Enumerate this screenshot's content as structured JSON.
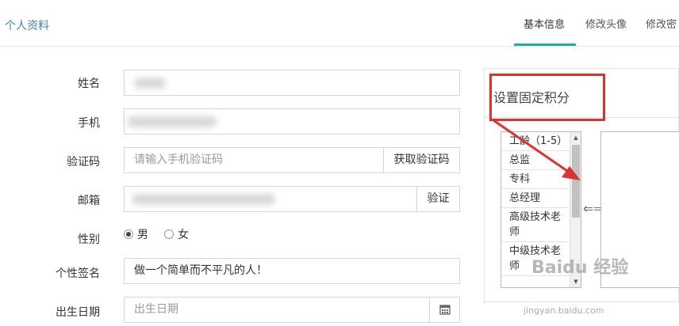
{
  "page_title": "个人资料",
  "tabs": [
    {
      "label": "基本信息",
      "active": true
    },
    {
      "label": "修改头像",
      "active": false
    },
    {
      "label": "修改密",
      "active": false
    }
  ],
  "form": {
    "name_label": "姓名",
    "phone_label": "手机",
    "captcha_label": "验证码",
    "captcha_placeholder": "请输入手机验证码",
    "captcha_button": "获取验证码",
    "email_label": "邮箱",
    "email_button": "验证",
    "gender_label": "性别",
    "gender_male": "男",
    "gender_female": "女",
    "gender_selected": "男",
    "signature_label": "个性签名",
    "signature_value": "做一个简单而不平凡的人！",
    "birthday_label": "出生日期",
    "birthday_placeholder": "出生日期"
  },
  "panel": {
    "title": "设置固定积分",
    "list_items": [
      "工龄（1-5）",
      "总监",
      "专科",
      "总经理",
      "高级技术老师",
      "中级技术老师"
    ],
    "swap_symbol": "⇐⇒"
  },
  "annotation_color": "#e03030",
  "watermark": {
    "text": "Baidu 经验",
    "url": "jingyan.baidu.com"
  }
}
